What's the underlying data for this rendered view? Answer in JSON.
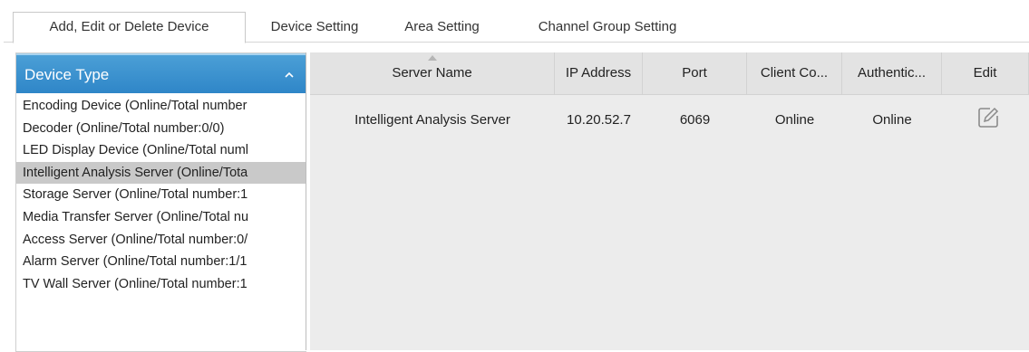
{
  "tabs": [
    {
      "label": "Add, Edit or Delete Device",
      "active": true
    },
    {
      "label": "Device Setting",
      "active": false
    },
    {
      "label": "Area Setting",
      "active": false
    },
    {
      "label": "Channel Group Setting",
      "active": false
    }
  ],
  "device_type_panel": {
    "title": "Device Type",
    "items": [
      {
        "label": "Encoding Device (Online/Total number"
      },
      {
        "label": "Decoder (Online/Total number:0/0)"
      },
      {
        "label": "LED Display Device (Online/Total numl"
      },
      {
        "label": "Intelligent Analysis Server (Online/Tota",
        "selected": true
      },
      {
        "label": "Storage Server (Online/Total number:1"
      },
      {
        "label": "Media Transfer Server (Online/Total nu"
      },
      {
        "label": "Access Server (Online/Total number:0/"
      },
      {
        "label": "Alarm Server (Online/Total number:1/1"
      },
      {
        "label": "TV Wall Server (Online/Total number:1"
      }
    ]
  },
  "table": {
    "headers": [
      "Server Name",
      "IP Address",
      "Port",
      "Client Co...",
      "Authentic...",
      "Edit"
    ],
    "rows": [
      {
        "server_name": "Intelligent Analysis Server",
        "ip": "10.20.52.7",
        "port": "6069",
        "client_conn": "Online",
        "auth": "Online"
      }
    ]
  },
  "icons": {
    "chevron": "chevron-up-icon",
    "sort": "sort-ascending-icon",
    "edit": "edit-icon"
  },
  "colors": {
    "header_blue": "#3a8fcf",
    "selected_row": "#c9c9c9",
    "table_bg": "#ececec"
  }
}
